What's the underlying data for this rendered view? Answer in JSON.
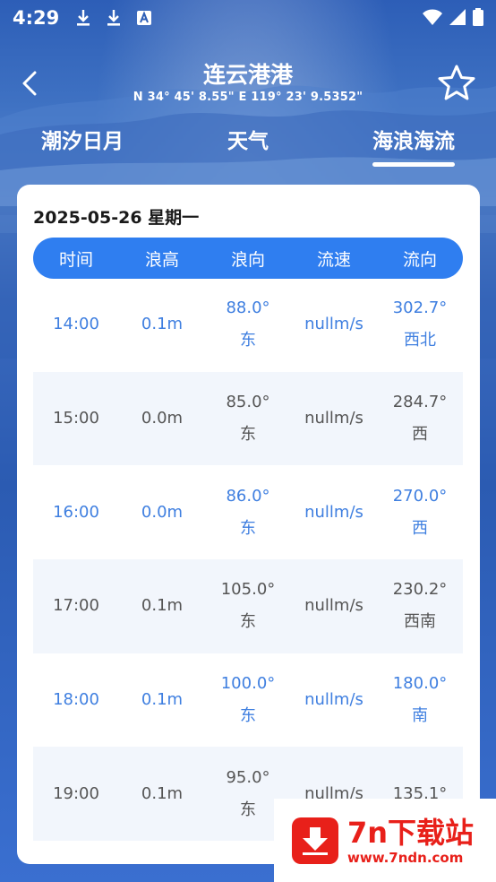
{
  "status_bar": {
    "time": "4:29",
    "icons": [
      "download-icon",
      "download-icon",
      "font-icon"
    ],
    "right_icons": [
      "wifi-icon",
      "signal-icon",
      "battery-icon"
    ]
  },
  "header": {
    "title": "连云港港",
    "coords": "N 34° 45' 8.55\"   E 119° 23' 9.5352\""
  },
  "tabs": [
    {
      "label": "潮汐日月",
      "active": false
    },
    {
      "label": "天气",
      "active": false
    },
    {
      "label": "海浪海流",
      "active": true
    }
  ],
  "card": {
    "date": "2025-05-26  星期一",
    "columns": [
      "时间",
      "浪高",
      "浪向",
      "流速",
      "流向"
    ],
    "rows": [
      {
        "time": "14:00",
        "wave_height": "0.1m",
        "wave_dir_deg": "88.0°",
        "wave_dir": "东",
        "flow_speed": "nullm/s",
        "flow_dir_deg": "302.7°",
        "flow_dir": "西北"
      },
      {
        "time": "15:00",
        "wave_height": "0.0m",
        "wave_dir_deg": "85.0°",
        "wave_dir": "东",
        "flow_speed": "nullm/s",
        "flow_dir_deg": "284.7°",
        "flow_dir": "西"
      },
      {
        "time": "16:00",
        "wave_height": "0.0m",
        "wave_dir_deg": "86.0°",
        "wave_dir": "东",
        "flow_speed": "nullm/s",
        "flow_dir_deg": "270.0°",
        "flow_dir": "西"
      },
      {
        "time": "17:00",
        "wave_height": "0.1m",
        "wave_dir_deg": "105.0°",
        "wave_dir": "东",
        "flow_speed": "nullm/s",
        "flow_dir_deg": "230.2°",
        "flow_dir": "西南"
      },
      {
        "time": "18:00",
        "wave_height": "0.1m",
        "wave_dir_deg": "100.0°",
        "wave_dir": "东",
        "flow_speed": "nullm/s",
        "flow_dir_deg": "180.0°",
        "flow_dir": "南"
      },
      {
        "time": "19:00",
        "wave_height": "0.1m",
        "wave_dir_deg": "95.0°",
        "wave_dir": "东",
        "flow_speed": "nullm/s",
        "flow_dir_deg": "135.1°",
        "flow_dir": ""
      }
    ]
  },
  "watermark": {
    "title": "7n下载站",
    "url": "www.7ndn.com"
  },
  "colors": {
    "accent": "#2f7ef0",
    "row_blue_text": "#3f7fe0",
    "row_gray_text": "#555555",
    "row_alt_bg": "#f2f6fc",
    "watermark_red": "#e8201a"
  }
}
